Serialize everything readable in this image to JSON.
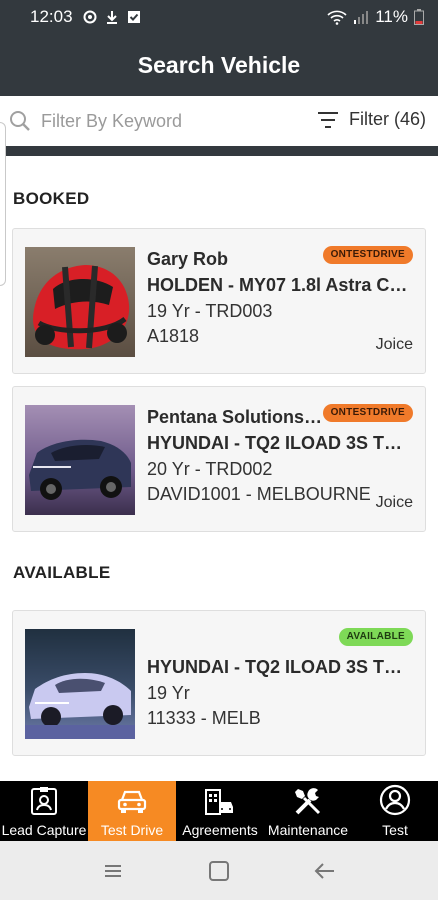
{
  "status_bar": {
    "time": "12:03",
    "battery": "11%"
  },
  "app_bar": {
    "title": "Search Vehicle"
  },
  "search": {
    "placeholder": "Filter By Keyword",
    "filter_label": "Filter (46)"
  },
  "sections": {
    "booked_title": "BOOKED",
    "available_title": "AVAILABLE"
  },
  "booked": [
    {
      "name": "Gary Rob",
      "model": "HOLDEN - MY07 1.8l Astra Cd ...",
      "line3": "19 Yr - TRD003",
      "line4": "A1818",
      "owner": "Joice",
      "badge": "ONTESTDRIVE"
    },
    {
      "name": "Pentana Solutions ...",
      "model": "HYUNDAI - TQ2 ILOAD 3S TWI...",
      "line3": "20 Yr - TRD002",
      "line4": "DAVID1001 - MELBOURNE",
      "owner": "Joice",
      "badge": "ONTESTDRIVE"
    }
  ],
  "available": [
    {
      "model": "HYUNDAI - TQ2 ILOAD 3S TWI...",
      "line3": "19 Yr",
      "line4": "11333 - MELB",
      "badge": "AVAILABLE"
    }
  ],
  "bottom_nav": [
    {
      "label": "Lead Capture",
      "icon": "badge-icon",
      "active": false
    },
    {
      "label": "Test Drive",
      "icon": "car-icon",
      "active": true
    },
    {
      "label": "Agreements",
      "icon": "building-car-icon",
      "active": false
    },
    {
      "label": "Maintenance",
      "icon": "tools-icon",
      "active": false
    },
    {
      "label": "Test",
      "icon": "user-circle-icon",
      "active": false
    }
  ],
  "colors": {
    "header": "#33393e",
    "accent": "#f68a23",
    "badge_testdrive": "#f07a2a",
    "badge_available": "#7ed957"
  }
}
